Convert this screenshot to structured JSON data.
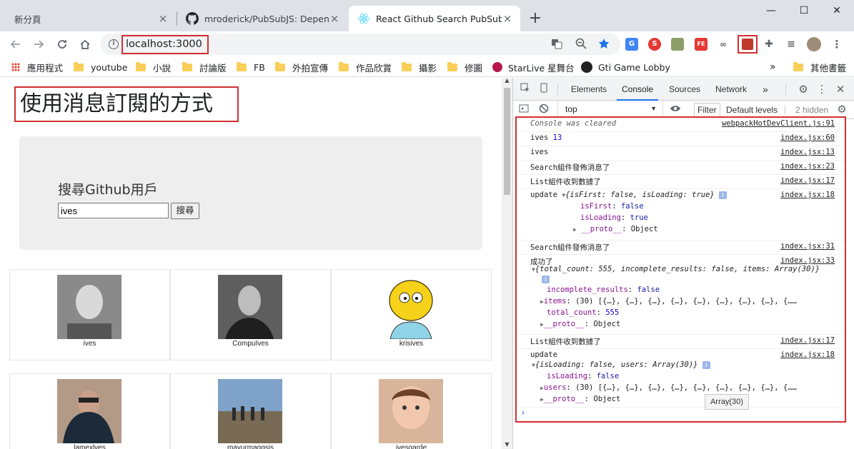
{
  "tabs": [
    {
      "label": "新分頁",
      "close": "×"
    },
    {
      "label": "mroderick/PubSubJS: Depende",
      "close": "×"
    },
    {
      "label": "React Github Search PubSub",
      "close": "×"
    }
  ],
  "new_tab": "+",
  "window_controls": {
    "minimize": "—",
    "maximize": "☐",
    "close": "✕"
  },
  "url": "localhost:3000",
  "bookmarks": [
    "應用程式",
    "youtube",
    "小說",
    "討論版",
    "FB",
    "外拍宣傳",
    "作品欣賞",
    "攝影",
    "修圖",
    "StarLive 星舞台",
    "Gti Game Lobby",
    "其他書籤"
  ],
  "bookmarks_overflow": "»",
  "page": {
    "heading": "使用消息訂閱的方式",
    "search_title": "搜尋Github用戶",
    "search_value": "ives",
    "search_button": "搜尋"
  },
  "users": [
    "ives",
    "CompuIves",
    "krisives",
    "lamexlves",
    "mayurmaggsis",
    "ivesgarde"
  ],
  "devtools": {
    "tabs": [
      "Elements",
      "Console",
      "Sources",
      "Network"
    ],
    "more": "»",
    "context": "top",
    "filter_placeholder": "Filter",
    "levels": "Default levels",
    "hidden": "2 hidden"
  },
  "console": {
    "cleared": "Console was cleared",
    "cleared_src": "webpackHotDevClient.js:91",
    "l1": "ives",
    "l1_num": "13",
    "l1_src": "index.jsx:60",
    "l2": "ives",
    "l2_src": "index.jsx:13",
    "l3": "Search組件發佈消息了",
    "l3_src": "index.jsx:23",
    "l4": "List組件收到數據了",
    "l4_src": "index.jsx:17",
    "l5": "update",
    "l5_src": "index.jsx:18",
    "l5_obj": "{isFirst: false, isLoading: true}",
    "l5_p1_key": "isFirst",
    "l5_p1_val": "false",
    "l5_p2_key": "isLoading",
    "l5_p2_val": "true",
    "proto": "__proto__",
    "proto_val": "Object",
    "l6": "Search組件發佈消息了",
    "l6_src": "index.jsx:31",
    "l7": "成功了",
    "l7_src": "index.jsx:33",
    "l7_obj": "{total_count: 555, incomplete_results: false, items: Array(30)}",
    "l7_p1_key": "incomplete_results",
    "l7_p1_val": "false",
    "l7_p2_key": "items",
    "l7_p2_val": "(30) [{…}, {…}, {…}, {…}, {…}, {…}, {…}, {…}, {……",
    "l7_p3_key": "total_count",
    "l7_p3_val": "555",
    "l8": "List組件收到數據了",
    "l8_src": "index.jsx:17",
    "l9": "update",
    "l9_src": "index.jsx:18",
    "l9_obj": "{isLoading: false, users: Array(30)}",
    "l9_p1_key": "isLoading",
    "l9_p1_val": "false",
    "l9_p2_key": "users",
    "l9_p2_val": "(30) [{…}, {…}, {…}, {…}, {…}, {…}, {…}, {…}, {……",
    "prompt": "›",
    "tooltip": "Array(30)"
  },
  "colors": {
    "highlight": "#d32f2f",
    "accent": "#1a73e8",
    "key": "#881391",
    "value": "#1a1aa6"
  }
}
